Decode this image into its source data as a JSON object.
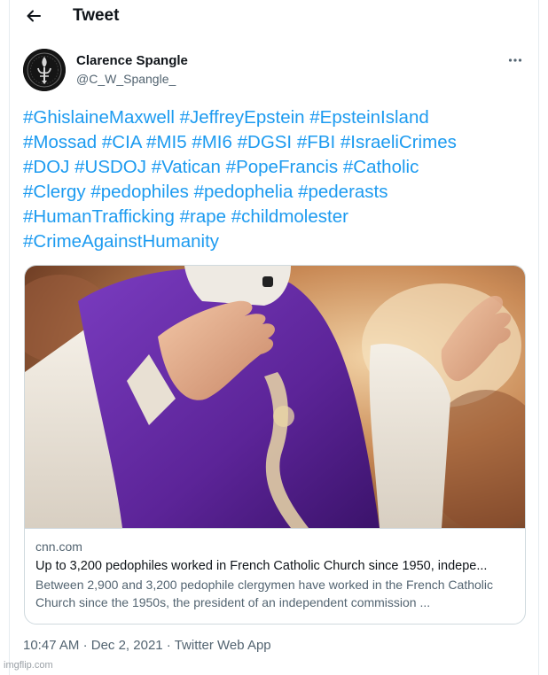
{
  "header": {
    "title": "Tweet",
    "back_icon": "arrow-left-icon"
  },
  "author": {
    "display_name": "Clarence Spangle",
    "handle": "@C_W_Spangle_",
    "more_icon": "more-horizontal-icon"
  },
  "tweet": {
    "lines": [
      [
        "#GhislaineMaxwell",
        "#JeffreyEpstein",
        "#EpsteinIsland"
      ],
      [
        "#Mossad",
        "#CIA",
        "#MI5",
        "#MI6",
        "#DGSI",
        "#FBI",
        "#IsraeliCrimes"
      ],
      [
        "#DOJ",
        "#USDOJ",
        "#Vatican",
        "#PopeFrancis",
        "#Catholic"
      ],
      [
        "#Clergy",
        "#pedophiles",
        "#pedophelia",
        "#pederasts"
      ],
      [
        "#HumanTrafficking",
        "#rape",
        "#childmolester"
      ],
      [
        "#CrimeAgainstHumanity"
      ]
    ]
  },
  "card": {
    "domain": "cnn.com",
    "title": "Up to 3,200 pedophiles worked in French Catholic Church since 1950, indepe...",
    "description": "Between 2,900 and 3,200 pedophile clergymen have worked in the French Catholic Church since the 1950s, the president of an independent commission ..."
  },
  "meta": {
    "time": "10:47 AM",
    "date": "Dec 2, 2021",
    "source": "Twitter Web App",
    "separator": "·"
  },
  "watermark": "imgflip.com",
  "colors": {
    "link": "#1d9bf0",
    "text": "#0f1419",
    "secondary": "#536471",
    "border": "#cfd9de"
  }
}
